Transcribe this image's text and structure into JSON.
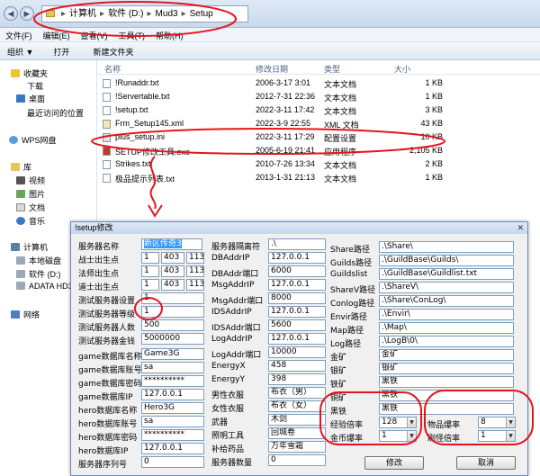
{
  "explorer": {
    "breadcrumbs": [
      "计算机",
      "软件 (D:)",
      "Mud3",
      "Setup"
    ],
    "menu": [
      "文件(F)",
      "编辑(E)",
      "查看(V)",
      "工具(T)",
      "帮助(H)"
    ],
    "toolbar": [
      "组织 ▼",
      "打开",
      "新建文件夹"
    ],
    "sidebar": {
      "favorites": "收藏夹",
      "downloads": "下载",
      "desktop": "桌面",
      "recent": "最近访问的位置",
      "wps": "WPS网盘",
      "library": "库",
      "video": "视频",
      "pictures": "图片",
      "docs": "文档",
      "music": "音乐",
      "computer": "计算机",
      "local_c": "本地磁盘",
      "soft_d": "软件 (D:)",
      "adata": "ADATA HD3",
      "network": "网络"
    },
    "columns": {
      "name": "名称",
      "date": "修改日期",
      "type": "类型",
      "size": "大小"
    },
    "files": [
      {
        "name": "!Runaddr.txt",
        "date": "2006-3-17 3:01",
        "type": "文本文档",
        "size": "1 KB",
        "icon": "#ffffff"
      },
      {
        "name": "!Servertable.txt",
        "date": "2012-7-31 22:36",
        "type": "文本文档",
        "size": "1 KB",
        "icon": "#ffffff"
      },
      {
        "name": "!setup.txt",
        "date": "2022-3-11 17:42",
        "type": "文本文档",
        "size": "3 KB",
        "icon": "#ffffff"
      },
      {
        "name": "Frm_Setup145.xml",
        "date": "2022-3-9 22:55",
        "type": "XML 文档",
        "size": "43 KB",
        "icon": "#f6e7b0"
      },
      {
        "name": "plus_setup.ini",
        "date": "2022-3-11 17:29",
        "type": "配置设置",
        "size": "10 KB",
        "icon": "#e0e0e0"
      },
      {
        "name": "SETUP修改工具.exe",
        "date": "2005-6-19 21:41",
        "type": "应用程序",
        "size": "2,105 KB",
        "icon": "#c0392b"
      },
      {
        "name": "Strikes.txt",
        "date": "2010-7-26 13:34",
        "type": "文本文档",
        "size": "2 KB",
        "icon": "#ffffff"
      },
      {
        "name": "极品提示列表.txt",
        "date": "2013-1-31 21:13",
        "type": "文本文档",
        "size": "1 KB",
        "icon": "#ffffff"
      }
    ]
  },
  "dialog": {
    "title": "!setup修改",
    "close": "✕",
    "col1": {
      "server_name_label": "服务器名称",
      "server_name": "新区传奇3",
      "warrior_label": "战士出生点",
      "warrior": [
        "1",
        "403",
        "113"
      ],
      "mage_label": "法师出生点",
      "mage": [
        "1",
        "403",
        "113"
      ],
      "taoist_label": "道士出生点",
      "taoist": [
        "1",
        "403",
        "113"
      ],
      "test_setting_label": "测试服务器设置",
      "test_setting": "1",
      "test_level_label": "测试服务器等级",
      "test_level": "1",
      "test_count_label": "测试服务器人数",
      "test_count": "500",
      "test_gold_label": "测试服务器金钱",
      "test_gold": "5000000",
      "game_db_name_label": "game数据库名称",
      "game_db_name": "Game3G",
      "game_db_user_label": "game数据库账号",
      "game_db_user": "sa",
      "game_db_pwd_label": "game数据库密码",
      "game_db_pwd": "**********",
      "game_db_ip_label": "game数据库IP",
      "game_db_ip": "127.0.0.1",
      "hero_db_name_label": "hero数据库名称",
      "hero_db_name": "Hero3G",
      "hero_db_user_label": "hero数据库账号",
      "hero_db_user": "sa",
      "hero_db_pwd_label": "hero数据库密码",
      "hero_db_pwd": "**********",
      "hero_db_ip_label": "hero数据库IP",
      "hero_db_ip": "127.0.0.1",
      "serial_label": "服务器序列号",
      "serial": "0"
    },
    "col2": {
      "sep_label": "服务器隔离符",
      "sep": ".\\",
      "dbaddr_ip_label": "DBAddrIP",
      "dbaddr_ip": "127.0.0.1",
      "dbaddr_port_label": "DBAddr端口",
      "dbaddr_port": "6000",
      "msgaddr_ip_label": "MsgAddrIP",
      "msgaddr_ip": "127.0.0.1",
      "msgaddr_port_label": "MsgAddr端口",
      "msgaddr_port": "8000",
      "ids_ip_label": "IDSAddrIP",
      "ids_ip": "127.0.0.1",
      "ids_port_label": "IDSAddr端口",
      "ids_port": "5600",
      "log_ip_label": "LogAddrIP",
      "log_ip": "127.0.0.1",
      "log_port_label": "LogAddr端口",
      "log_port": "10000",
      "energy_x_label": "EnergyX",
      "energy_x": "458",
      "energy_y_label": "EnergyY",
      "energy_y": "398",
      "male_cloth_label": "男性衣服",
      "male_cloth": "布衣（男）",
      "female_cloth_label": "女性衣服",
      "female_cloth": "布衣（女）",
      "weapon_label": "武器",
      "weapon": "木剑",
      "light_label": "照明工具",
      "light": "回城卷",
      "supply_label": "补给药品",
      "supply": "万年雪霜",
      "server_count_label": "服务器数量",
      "server_count": "0"
    },
    "col3": {
      "share_label": "Share路径",
      "share": ".\\Share\\",
      "guilds_label": "Guilds路径",
      "guilds": ".\\GuildBase\\Guilds\\",
      "guildslist_label": "Guildslist",
      "guildslist": ".\\GuildBase\\Guildlist.txt",
      "sharev_label": "ShareV路径",
      "sharev": ".\\ShareV\\",
      "conlog_label": "Conlog路径",
      "conlog": ".\\Share\\ConLog\\",
      "envir_label": "Envir路径",
      "envir": ".\\Envir\\",
      "map_label": "Map路径",
      "map": ".\\Map\\",
      "log_label": "Log路径",
      "log": ".\\LogB\\0\\",
      "gold_ore_label": "金矿",
      "gold_ore": "金矿",
      "silver_ore_label": "银矿",
      "silver_ore": "银矿",
      "iron_ore_label": "铁矿",
      "iron_ore": "黑铁",
      "copper_ore_label": "铜矿",
      "copper_ore": "黑铁",
      "black_iron_label": "黑铁",
      "black_iron": "黑铁",
      "exp_rate_label": "经验倍率",
      "exp_rate": "128",
      "gold_rate_label": "金币爆率",
      "gold_rate": "1",
      "item_rate_label": "物品爆率",
      "item_rate": "8",
      "rare_rate_label": "刷怪倍率",
      "rare_rate": "1"
    },
    "modify_button": "修改",
    "cancel_button": "取消"
  },
  "annotation_color": "#e4141e"
}
